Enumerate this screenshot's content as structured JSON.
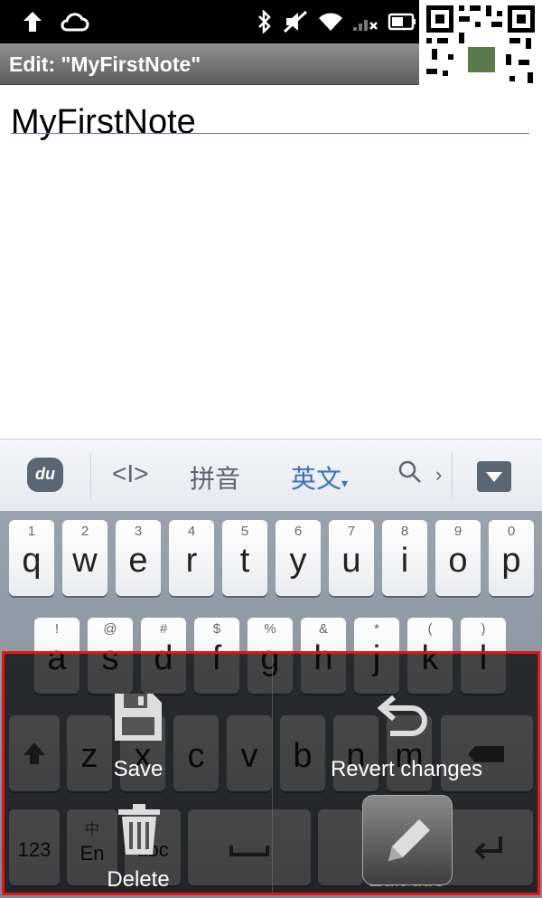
{
  "statusbar": {
    "icons": [
      "upload-arrow-icon",
      "cloud-icon",
      "bluetooth-icon",
      "mute-icon",
      "wifi-icon",
      "signal-icon",
      "battery-icon"
    ]
  },
  "titlebar": {
    "title": "Edit: \"MyFirstNote\""
  },
  "note": {
    "title": "MyFirstNote"
  },
  "ime": {
    "logo": "du",
    "cursor": "<I>",
    "pinyin": "拼音",
    "english": "英文",
    "search": "Q",
    "more": "›"
  },
  "keyboard": {
    "row1": [
      {
        "num": "1",
        "ch": "q"
      },
      {
        "num": "2",
        "ch": "w"
      },
      {
        "num": "3",
        "ch": "e"
      },
      {
        "num": "4",
        "ch": "r"
      },
      {
        "num": "5",
        "ch": "t"
      },
      {
        "num": "6",
        "ch": "y"
      },
      {
        "num": "7",
        "ch": "u"
      },
      {
        "num": "8",
        "ch": "i"
      },
      {
        "num": "9",
        "ch": "o"
      },
      {
        "num": "0",
        "ch": "p"
      }
    ],
    "row2": [
      {
        "num": "!",
        "ch": "a"
      },
      {
        "num": "@",
        "ch": "s"
      },
      {
        "num": "#",
        "ch": "d"
      },
      {
        "num": "$",
        "ch": "f"
      },
      {
        "num": "%",
        "ch": "g"
      },
      {
        "num": "&",
        "ch": "h"
      },
      {
        "num": "*",
        "ch": "j"
      },
      {
        "num": "(",
        "ch": "k"
      },
      {
        "num": ")",
        "ch": "l"
      }
    ],
    "row3": [
      {
        "ch": "z"
      },
      {
        "ch": "x"
      },
      {
        "ch": "c"
      },
      {
        "ch": "v"
      },
      {
        "ch": "b"
      },
      {
        "ch": "n"
      },
      {
        "ch": "m"
      }
    ],
    "row4": {
      "numkey": "123",
      "cn": "中",
      "en": "En",
      "abc": "abc"
    }
  },
  "menu": {
    "save": "Save",
    "revert": "Revert changes",
    "delete": "Delete",
    "edit_title": "Edit title"
  }
}
